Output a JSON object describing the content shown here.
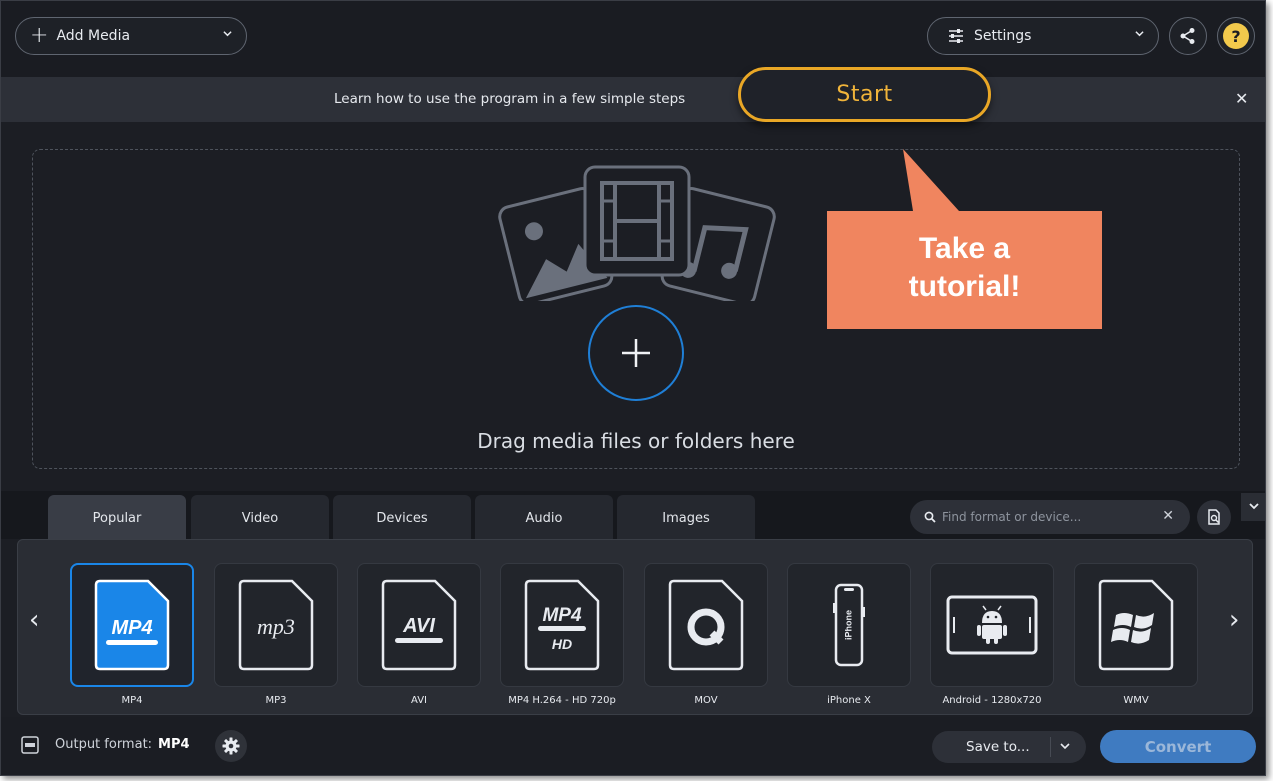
{
  "topbar": {
    "add_media_label": "Add Media",
    "settings_label": "Settings"
  },
  "tutorial_bar": {
    "message": "Learn how to use the program in a few simple steps",
    "start_label": "Start"
  },
  "callout": {
    "line1": "Take a",
    "line2": "tutorial!"
  },
  "dropzone": {
    "text": "Drag media files or folders here"
  },
  "tabs": [
    {
      "label": "Popular",
      "active": true
    },
    {
      "label": "Video",
      "active": false
    },
    {
      "label": "Devices",
      "active": false
    },
    {
      "label": "Audio",
      "active": false
    },
    {
      "label": "Images",
      "active": false
    }
  ],
  "search": {
    "placeholder": "Find format or device..."
  },
  "formats": [
    {
      "label": "MP4",
      "icon": "mp4-video-icon",
      "selected": true
    },
    {
      "label": "MP3",
      "icon": "mp3-audio-icon",
      "selected": false
    },
    {
      "label": "AVI",
      "icon": "avi-video-icon",
      "selected": false
    },
    {
      "label": "MP4 H.264 - HD 720p",
      "icon": "mp4-hd-icon",
      "selected": false
    },
    {
      "label": "MOV",
      "icon": "quicktime-mov-icon",
      "selected": false
    },
    {
      "label": "iPhone X",
      "icon": "iphone-icon",
      "selected": false
    },
    {
      "label": "Android - 1280x720",
      "icon": "android-tablet-icon",
      "selected": false
    },
    {
      "label": "WMV",
      "icon": "windows-wmv-icon",
      "selected": false
    }
  ],
  "format_icon_text": {
    "mp4": "MP4",
    "mp3": "mp3",
    "avi": "AVI",
    "hd": "HD",
    "iphone": "iPhone"
  },
  "bottom": {
    "output_label": "Output format:",
    "output_value": "MP4",
    "save_to_label": "Save to...",
    "convert_label": "Convert"
  },
  "colors": {
    "accent_blue": "#1a86e8",
    "start_orange": "#e9a726",
    "callout": "#f0855f",
    "convert": "#3f7bc1"
  }
}
